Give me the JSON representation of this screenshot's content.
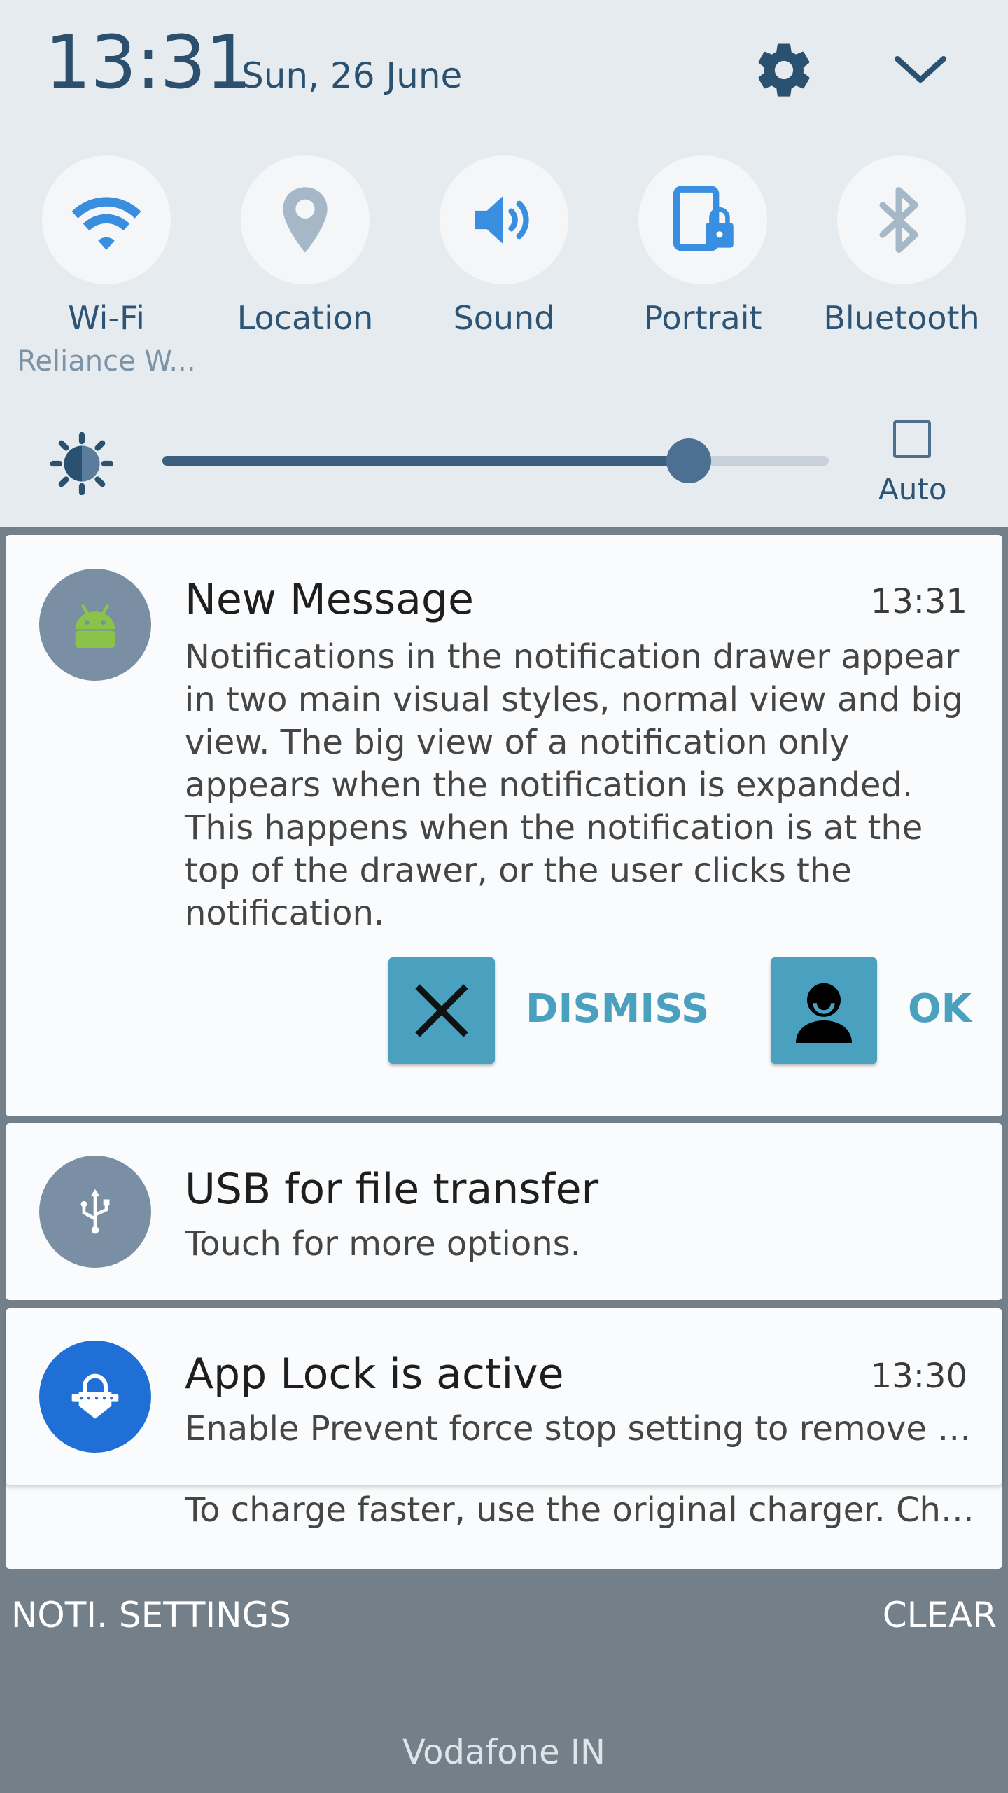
{
  "status": {
    "time": "13:31",
    "date": "Sun, 26 June"
  },
  "quick_toggles": [
    {
      "label": "Wi-Fi",
      "sub": "Reliance W...",
      "icon": "wifi-icon"
    },
    {
      "label": "Location",
      "sub": "",
      "icon": "location-icon"
    },
    {
      "label": "Sound",
      "sub": "",
      "icon": "sound-icon"
    },
    {
      "label": "Portrait",
      "sub": "",
      "icon": "portrait-lock-icon"
    },
    {
      "label": "Bluetooth",
      "sub": "",
      "icon": "bluetooth-icon"
    }
  ],
  "brightness": {
    "level": 0.79,
    "auto_label": "Auto",
    "auto_checked": false
  },
  "notifications": [
    {
      "title": "New Message",
      "time": "13:31",
      "text": "Notifications in the notification drawer appear in two main visual styles, normal view and big view. The big view of a notification only appears when the notification is expanded. This happens when the notification is at the top of the drawer, or the user clicks the notification.",
      "actions": [
        {
          "label": "DISMISS",
          "icon": "close-icon"
        },
        {
          "label": "OK",
          "icon": "person-icon"
        }
      ]
    },
    {
      "title": "USB for file transfer",
      "time": "",
      "text": "Touch for more options."
    },
    {
      "title": "App Lock is active",
      "time": "13:30",
      "text": "Enable Prevent force stop setting to remove thi.."
    },
    {
      "title": "",
      "time": "",
      "text": "To charge faster, use the original charger. Char.."
    }
  ],
  "footer": {
    "settings_label": "NOTI. SETTINGS",
    "clear_label": "CLEAR",
    "carrier": "Vodafone IN"
  },
  "colors": {
    "panel_bg": "#e6ebf0",
    "accent_blue": "#3a8ee0",
    "action_teal": "#4aa0bf",
    "drawer_bg": "#737f89",
    "applock_blue": "#1f6fd6"
  }
}
